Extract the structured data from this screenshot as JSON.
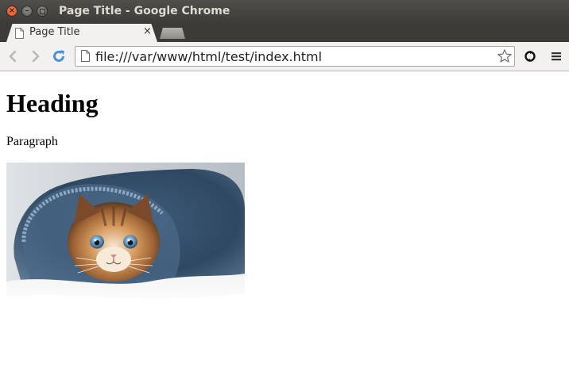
{
  "window": {
    "title": "Page Title - Google Chrome",
    "close_glyph": "×",
    "minimize_glyph": "–",
    "maximize_glyph": "□"
  },
  "tabs": [
    {
      "label": "Page Title",
      "close_glyph": "×",
      "icon": "page-icon"
    }
  ],
  "toolbar": {
    "back_icon": "back-arrow-icon",
    "forward_icon": "forward-arrow-icon",
    "reload_icon": "reload-icon",
    "bookmark_icon": "star-icon",
    "extension_icon": "sync-icon",
    "menu_icon": "hamburger-menu-icon"
  },
  "omnibox": {
    "url": "file:///var/www/html/test/index.html"
  },
  "page": {
    "heading": "Heading",
    "paragraph": "Paragraph",
    "image": "kitten-in-jeans-photo"
  },
  "colors": {
    "titlebar": "#3c3b37",
    "close_button": "#df4a16",
    "toolbar": "#f2f1f0",
    "reload_blue": "#4a90d9"
  }
}
